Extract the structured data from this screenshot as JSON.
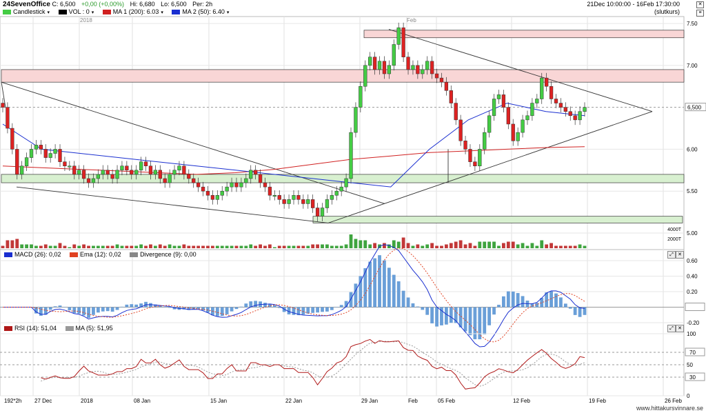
{
  "header": {
    "symbol": "24SevenOffice",
    "close": "C: 6,500",
    "change": "+0,00 (+0,00%)",
    "high": "Hi: 6,680",
    "low": "Lo: 6,500",
    "period": "Per: 2h",
    "date_range": "21Dec 10:00:00 - 16Feb 17:30:00",
    "status": "(slutkurs)"
  },
  "legend": [
    {
      "label": "Candlestick",
      "color": "#44cc44",
      "dropdown": "▾"
    },
    {
      "label": "VOL : 0",
      "color": "#000000",
      "dropdown": "▾"
    },
    {
      "label": "MA 1 (200): 6.03",
      "color": "#d02020",
      "dropdown": "▾"
    },
    {
      "label": "MA 2 (50): 6.40",
      "color": "#1a2fd0",
      "dropdown": "▾"
    }
  ],
  "price_axis": {
    "ticks": [
      "7.50",
      "7.00",
      "6.00",
      "5.50",
      "5.00"
    ],
    "last_price_label": "6,500",
    "vol_ticks": [
      "4000T",
      "2000T"
    ]
  },
  "year_labels": [
    "2018",
    "Feb"
  ],
  "x_axis": [
    "192*2h",
    "27 Dec",
    "2018",
    "08 Jan",
    "15 Jan",
    "22 Jan",
    "29 Jan",
    "Feb",
    "05 Feb",
    "12 Feb",
    "19 Feb",
    "26 Feb"
  ],
  "macd": {
    "legend": [
      {
        "label": "MACD (26): 0,02",
        "color": "#1a2fd0"
      },
      {
        "label": "Ema (12): 0,02",
        "color": "#e04020"
      },
      {
        "label": "Divergence (9): 0,00",
        "color": "#888888"
      }
    ],
    "ticks": [
      "0.60",
      "0.40",
      "0.20",
      "0",
      "-0.20"
    ]
  },
  "rsi": {
    "legend": [
      {
        "label": "RSI (14): 51,04",
        "color": "#b01818"
      },
      {
        "label": "MA (5): 51,95",
        "color": "#999999"
      }
    ],
    "ticks": [
      "100",
      "70",
      "50",
      "30",
      "0"
    ]
  },
  "website": "www.hittakursvinnare.se",
  "chart_data": {
    "type": "candlestick",
    "symbol": "24SevenOffice",
    "interval": "2h",
    "ylim": [
      5.0,
      7.55
    ],
    "x": [
      "27 Dec",
      "2018",
      "08 Jan",
      "15 Jan",
      "22 Jan",
      "29 Jan",
      "Feb",
      "05 Feb",
      "12 Feb",
      "19 Feb",
      "26 Feb"
    ],
    "close_series": [
      6.5,
      6.25,
      6.0,
      5.7,
      5.8,
      5.9,
      6.0,
      6.05,
      6.0,
      5.9,
      5.95,
      6.0,
      5.85,
      5.8,
      5.8,
      5.7,
      5.75,
      5.65,
      5.6,
      5.65,
      5.7,
      5.75,
      5.7,
      5.65,
      5.75,
      5.8,
      5.75,
      5.7,
      5.75,
      5.85,
      5.8,
      5.7,
      5.75,
      5.65,
      5.6,
      5.7,
      5.75,
      5.8,
      5.7,
      5.65,
      5.6,
      5.55,
      5.5,
      5.45,
      5.4,
      5.45,
      5.5,
      5.55,
      5.6,
      5.55,
      5.6,
      5.65,
      5.75,
      5.7,
      5.6,
      5.55,
      5.45,
      5.45,
      5.4,
      5.35,
      5.4,
      5.45,
      5.4,
      5.35,
      5.4,
      5.3,
      5.2,
      5.3,
      5.4,
      5.45,
      5.5,
      5.55,
      5.65,
      6.2,
      6.5,
      6.75,
      7.0,
      7.1,
      6.95,
      7.05,
      6.9,
      7.0,
      7.25,
      7.45,
      7.1,
      6.95,
      7.0,
      6.9,
      6.95,
      7.05,
      6.9,
      6.85,
      6.8,
      6.7,
      6.55,
      6.35,
      6.1,
      6.0,
      5.85,
      5.8,
      6.0,
      6.2,
      6.4,
      6.6,
      6.65,
      6.5,
      6.3,
      6.1,
      6.2,
      6.35,
      6.4,
      6.55,
      6.6,
      6.85,
      6.75,
      6.6,
      6.55,
      6.5,
      6.45,
      6.4,
      6.35,
      6.45,
      6.5
    ],
    "ma_200": [
      5.8,
      5.78,
      5.76,
      5.74,
      5.72,
      5.7,
      5.72,
      5.76,
      5.82,
      5.88,
      5.92,
      5.96,
      5.98,
      6.0,
      6.02,
      6.03
    ],
    "ma_50": [
      6.3,
      6.0,
      5.95,
      5.9,
      5.85,
      5.8,
      5.75,
      5.7,
      5.65,
      5.6,
      5.55,
      6.0,
      6.35,
      6.55,
      6.45,
      6.4
    ],
    "zones": [
      {
        "type": "resistance",
        "from": 7.33,
        "to": 7.42
      },
      {
        "type": "resistance",
        "from": 6.8,
        "to": 6.95
      },
      {
        "type": "support",
        "from": 5.6,
        "to": 5.7
      },
      {
        "type": "support",
        "from": 5.12,
        "to": 5.2
      }
    ],
    "last_price": 6.5,
    "macd": {
      "macd": 0.02,
      "ema": 0.02,
      "divergence": 0.0,
      "ylim": [
        -0.2,
        0.6
      ]
    },
    "rsi": {
      "rsi": 51.04,
      "ma": 51.95,
      "ylim": [
        0,
        100
      ],
      "levels": [
        70,
        50,
        30
      ]
    }
  }
}
